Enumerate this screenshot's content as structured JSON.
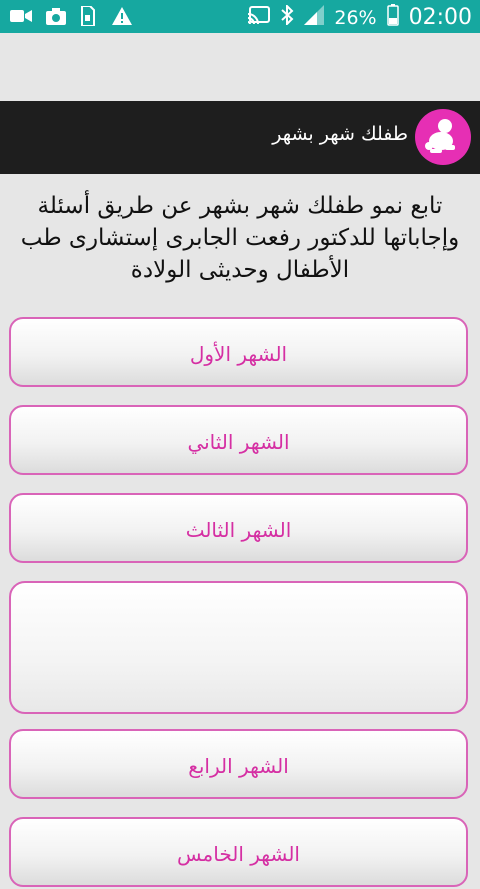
{
  "status_bar": {
    "battery_percent": "26%",
    "clock": "02:00",
    "left_icons": [
      "video-icon",
      "camera-icon",
      "sim-card-icon",
      "warning-icon"
    ],
    "right_icons": [
      "cast-icon",
      "bluetooth-icon",
      "signal-icon",
      "battery-icon"
    ]
  },
  "app_bar": {
    "title": "طفلك شهر بشهر",
    "logo_color": "#e62fb4",
    "background": "#1e1e1e"
  },
  "intro": {
    "text": "تابع نمو طفلك شهر بشهر عن طريق أسئلة وإجاباتها للدكتور رفعت الجابرى إستشارى طب الأطفال وحديثى الولادة"
  },
  "months": {
    "first": "الشهر الأول",
    "second": "الشهر الثاني",
    "third": "الشهر الثالث",
    "fourth": "الشهر الرابع",
    "fifth": "الشهر الخامس"
  },
  "colors": {
    "status_bar": "#16a8a0",
    "button_border": "#d964b8",
    "button_text": "#d52fa3",
    "page_background": "#e6e6e6"
  }
}
